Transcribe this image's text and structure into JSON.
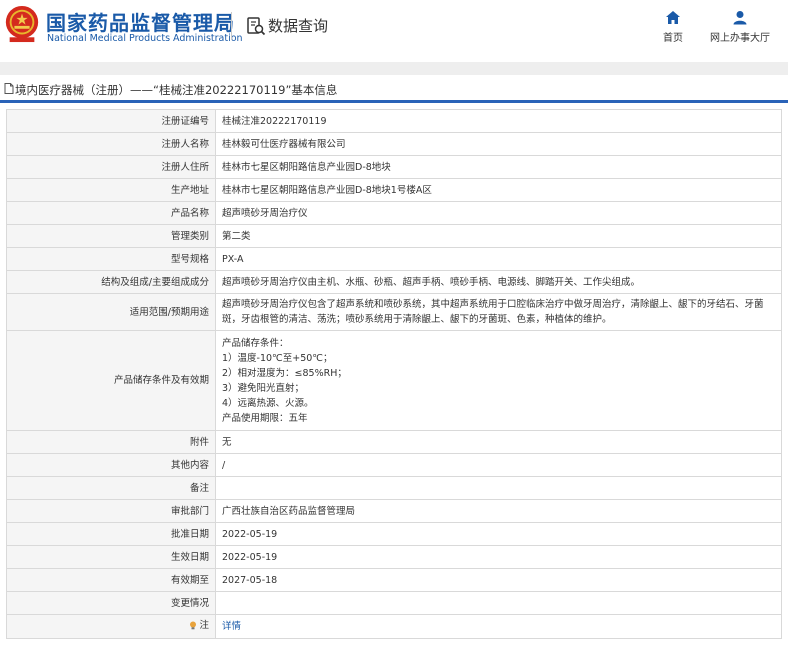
{
  "header": {
    "agency_cn": "国家药品监督管理局",
    "agency_en": "National Medical Products Administration",
    "query_title": "数据查询",
    "nav": [
      {
        "label": "首页",
        "icon": "home-icon"
      },
      {
        "label": "网上办事大厅",
        "icon": "person-icon"
      }
    ]
  },
  "title_bar": {
    "text": "境内医疗器械（注册）——“桂械注准20222170119”基本信息"
  },
  "rows": {
    "reg_no": {
      "label": "注册证编号",
      "value": "桂械注准20222170119"
    },
    "registrant": {
      "label": "注册人名称",
      "value": "桂林毅可仕医疗器械有限公司"
    },
    "registrant_addr": {
      "label": "注册人住所",
      "value": "桂林市七星区朝阳路信息产业园D-8地块"
    },
    "production_addr": {
      "label": "生产地址",
      "value": "桂林市七星区朝阳路信息产业园D-8地块1号楼A区"
    },
    "product_name": {
      "label": "产品名称",
      "value": "超声喷砂牙周治疗仪"
    },
    "mgmt_class": {
      "label": "管理类别",
      "value": "第二类"
    },
    "model": {
      "label": "型号规格",
      "value": "PX-A"
    },
    "composition": {
      "label": "结构及组成/主要组成成分",
      "value": "超声喷砂牙周治疗仪由主机、水瓶、砂瓶、超声手柄、喷砂手柄、电源线、脚踏开关、工作尖组成。"
    },
    "scope": {
      "label": "适用范围/预期用途",
      "value": "超声喷砂牙周治疗仪包含了超声系统和喷砂系统，其中超声系统用于口腔临床治疗中做牙周治疗，清除龈上、龈下的牙结石、牙菌斑，牙齿根管的清洁、荡洗；喷砂系统用于清除龈上、龈下的牙菌斑、色素，种植体的维护。"
    },
    "storage": {
      "label": "产品储存条件及有效期",
      "lines": [
        "产品储存条件：",
        "1）温度-10℃至+50℃；",
        "2）相对湿度为：≤85%RH；",
        "3）避免阳光直射；",
        "4）远离热源、火源。",
        "产品使用期限：五年"
      ]
    },
    "attachment": {
      "label": "附件",
      "value": "无"
    },
    "other": {
      "label": "其他内容",
      "value": "/"
    },
    "remark": {
      "label": "备注",
      "value": ""
    },
    "approval_dept": {
      "label": "审批部门",
      "value": "广西壮族自治区药品监督管理局"
    },
    "approval_date": {
      "label": "批准日期",
      "value": "2022-05-19"
    },
    "effective_date": {
      "label": "生效日期",
      "value": "2022-05-19"
    },
    "expiry_date": {
      "label": "有效期至",
      "value": "2027-05-18"
    },
    "change": {
      "label": "变更情况",
      "value": ""
    },
    "note": {
      "label": "注",
      "value": "详情"
    }
  },
  "colors": {
    "brand_blue": "#1a5aa8",
    "title_underline": "#2a63b8",
    "label_bg": "#f5f5f5",
    "border": "#d9d9d9"
  }
}
